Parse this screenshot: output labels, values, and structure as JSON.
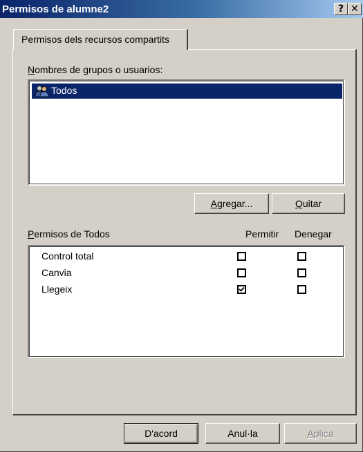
{
  "window": {
    "title": "Permisos de alumne2",
    "help_label": "?",
    "close_label": "✕"
  },
  "tab": {
    "label": "Permisos dels recursos compartits"
  },
  "users": {
    "label_accel": "N",
    "label_rest": "ombres de grupos o usuarios:",
    "items": [
      {
        "name": "Todos",
        "icon": "group-icon",
        "selected": true
      }
    ]
  },
  "buttons": {
    "add_accel": "A",
    "add_rest": "gregar...",
    "remove_accel": "Q",
    "remove_rest": "uitar"
  },
  "permissions": {
    "label_accel": "P",
    "label_rest": "ermisos de Todos",
    "allow_header": "Permitir",
    "deny_header": "Denegar",
    "rows": [
      {
        "name": "Control total",
        "allow": false,
        "deny": false
      },
      {
        "name": "Canvia",
        "allow": false,
        "deny": false
      },
      {
        "name": "Llegeix",
        "allow": true,
        "deny": false
      }
    ]
  },
  "footer": {
    "ok_label": "D'acord",
    "cancel_label": "Anul·la",
    "apply_accel": "A",
    "apply_rest": "plica"
  },
  "colors": {
    "title_bar_start": "#0a246a",
    "selection": "#0a246a",
    "face": "#d4d0c8"
  }
}
